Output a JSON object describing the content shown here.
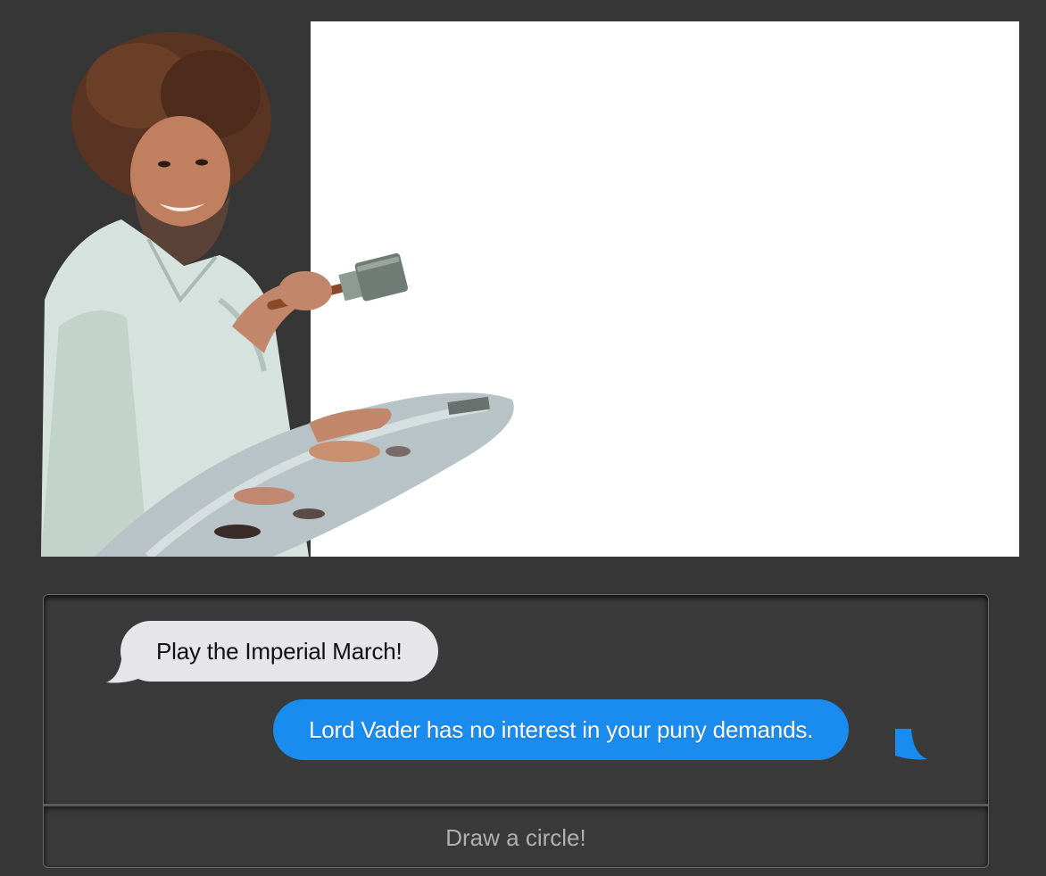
{
  "messages": [
    {
      "sender": "them",
      "text": "Play the Imperial March!"
    },
    {
      "sender": "me",
      "text": "Lord Vader has no interest in your puny demands."
    }
  ],
  "input": {
    "placeholder": "Draw a circle!",
    "value": ""
  },
  "colors": {
    "page_bg": "#363636",
    "panel_bg": "#3a3a3a",
    "incoming_bubble": "#e6e5ea",
    "outgoing_bubble": "#1a8cf0",
    "canvas": "#ffffff"
  },
  "images": {
    "painter": "painter-with-brush-and-palette"
  }
}
